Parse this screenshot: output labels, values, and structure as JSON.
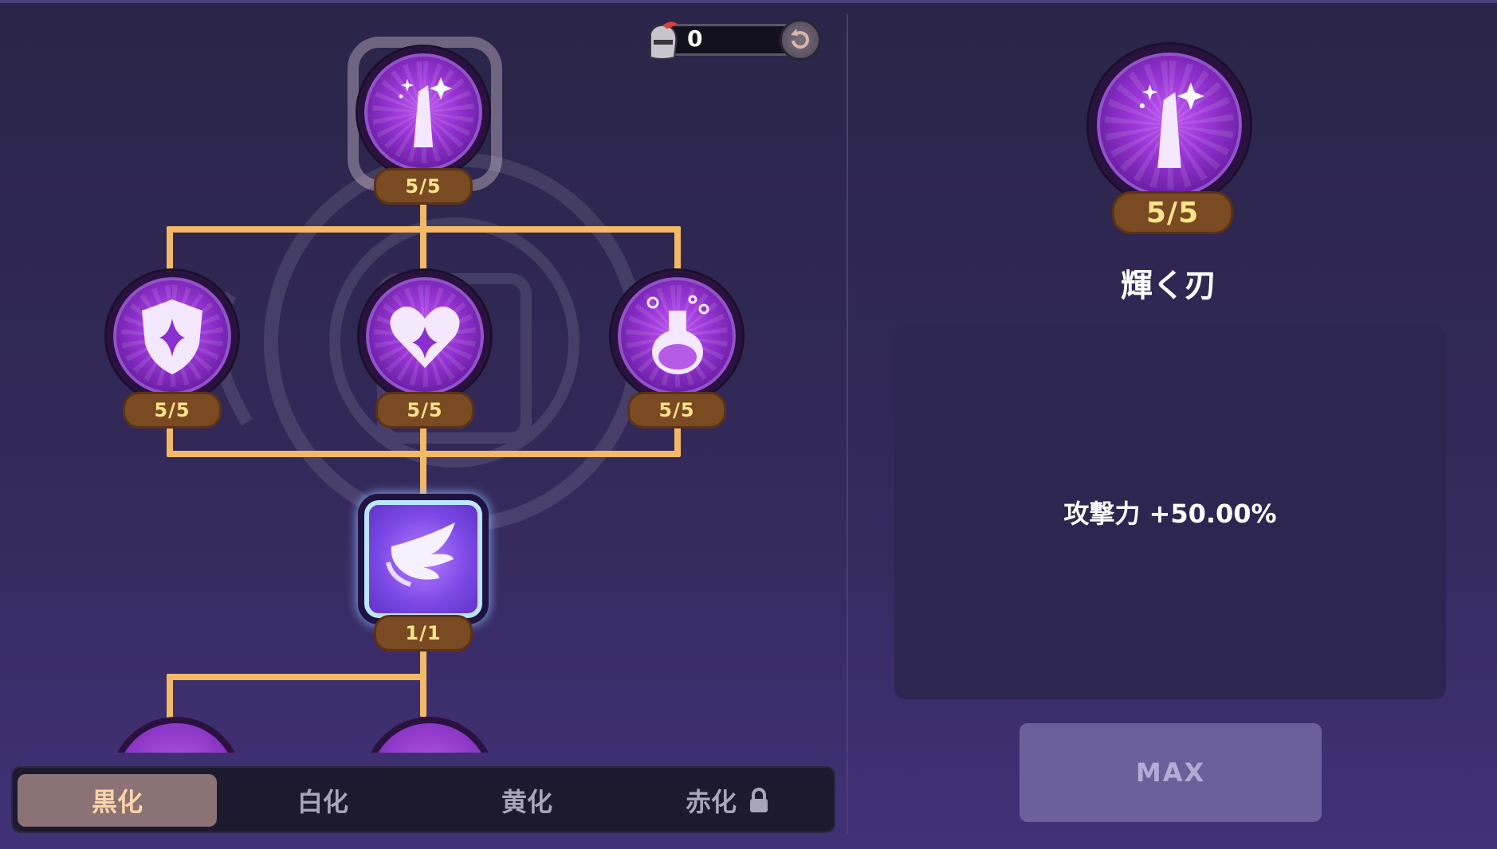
{
  "currency": {
    "amount": "0",
    "icon": "knight-helmet-icon"
  },
  "tree": {
    "top_node": {
      "icon": "sparkle-blade-icon",
      "level": "5/5"
    },
    "row2": [
      {
        "icon": "shield-icon",
        "level": "5/5"
      },
      {
        "icon": "heart-icon",
        "level": "5/5"
      },
      {
        "icon": "potion-icon",
        "level": "5/5"
      }
    ],
    "special_node": {
      "icon": "wing-icon",
      "level": "1/1"
    }
  },
  "tabs": [
    {
      "label": "黒化",
      "active": true,
      "locked": false
    },
    {
      "label": "白化",
      "active": false,
      "locked": false
    },
    {
      "label": "黄化",
      "active": false,
      "locked": false
    },
    {
      "label": "赤化",
      "active": false,
      "locked": true
    }
  ],
  "detail": {
    "level": "5/5",
    "name": "輝く刃",
    "description": "攻撃力 +50.00%",
    "button_label": "MAX"
  },
  "colors": {
    "connector": "#f2b967",
    "badge_bg": "#7a4a22",
    "badge_text": "#ffe48a",
    "active_tab_bg": "#8a7275",
    "max_button_bg": "#6c5f9a"
  }
}
